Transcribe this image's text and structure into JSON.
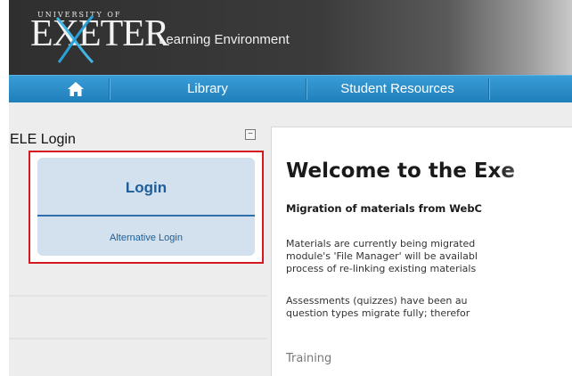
{
  "header": {
    "logo_university": "UNIVERSITY OF",
    "logo_word": "EXETER",
    "subtitle": "Learning Environment"
  },
  "nav": {
    "home_icon": "home-icon",
    "items": [
      {
        "label": "Library"
      },
      {
        "label": "Student Resources"
      }
    ]
  },
  "sidebar": {
    "title": "ELE Login",
    "collapse_symbol": "−",
    "login_label": "Login",
    "alt_login_label": "Alternative Login"
  },
  "content": {
    "heading": "Welcome to the Exe",
    "migration_title": "Migration of materials from WebC",
    "para1": [
      "Materials are currently being migrated",
      "module's 'File Manager' will be availabl",
      "process of re-linking existing materials"
    ],
    "para2": [
      "Assessments (quizzes) have been au",
      "question types migrate fully; therefor"
    ],
    "training": "Training"
  },
  "colors": {
    "nav_blue": "#2a8fca",
    "login_panel": "#d3e1ee",
    "highlight_red": "#d6181f",
    "link_blue": "#1d5d98"
  }
}
